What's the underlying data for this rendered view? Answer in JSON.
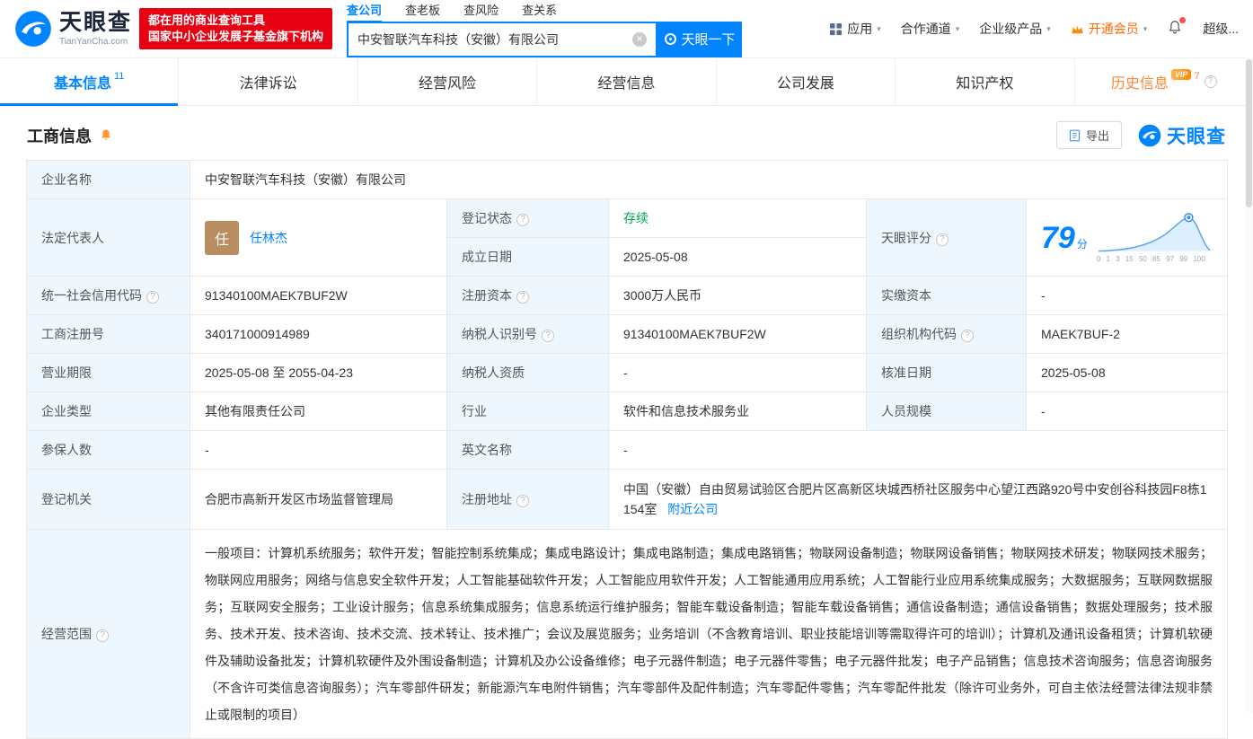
{
  "colors": {
    "brand_blue": "#0084ff",
    "promo_red": "#e60012",
    "status_green": "#00a854",
    "vip_orange": "#ff6a00",
    "history_orange": "#ff8534",
    "label_bg": "#eef7fe"
  },
  "header": {
    "brand": "天眼查",
    "brand_sub": "TianYanCha.com",
    "promo_line1": "都在用的商业查询工具",
    "promo_line2": "国家中小企业发展子基金旗下机构",
    "search_tabs": [
      {
        "label": "查公司"
      },
      {
        "label": "查老板"
      },
      {
        "label": "查风险"
      },
      {
        "label": "查关系"
      }
    ],
    "search_value": "中安智联汽车科技（安徽）有限公司",
    "search_button": "天眼一下",
    "nav": {
      "app": "应用",
      "cooperation": "合作通道",
      "enterprise": "企业级产品",
      "vip": "开通会员",
      "user": "超级..."
    }
  },
  "tabs": [
    {
      "label": "基本信息",
      "count": "11"
    },
    {
      "label": "法律诉讼"
    },
    {
      "label": "经营风险"
    },
    {
      "label": "经营信息"
    },
    {
      "label": "公司发展"
    },
    {
      "label": "知识产权"
    },
    {
      "label": "历史信息",
      "count": "7",
      "badge": "VIP"
    }
  ],
  "section": {
    "title": "工商信息",
    "export_label": "导出",
    "brand": "天眼查"
  },
  "score": {
    "value": "79",
    "unit": "分",
    "axis": "0 1 3 15 50 85 97 99 100"
  },
  "info": {
    "labels": {
      "company_name": "企业名称",
      "legal_rep": "法定代表人",
      "reg_status": "登记状态",
      "establish_date": "成立日期",
      "score": "天眼评分",
      "credit_code": "统一社会信用代码",
      "reg_capital": "注册资本",
      "paid_capital": "实缴资本",
      "reg_number": "工商注册号",
      "taxpayer_id": "纳税人识别号",
      "org_code": "组织机构代码",
      "business_term": "营业期限",
      "taxpayer_quality": "纳税人资质",
      "approval_date": "核准日期",
      "company_type": "企业类型",
      "industry": "行业",
      "staff_size": "人员规模",
      "insured_count": "参保人数",
      "english_name": "英文名称",
      "reg_authority": "登记机关",
      "reg_address": "注册地址",
      "business_scope": "经营范围"
    },
    "values": {
      "company_name": "中安智联汽车科技（安徽）有限公司",
      "legal_rep": "任林杰",
      "legal_rep_avatar": "任",
      "reg_status": "存续",
      "establish_date": "2025-05-08",
      "credit_code": "91340100MAEK7BUF2W",
      "reg_capital": "3000万人民币",
      "paid_capital": "-",
      "reg_number": "340171000914989",
      "taxpayer_id": "91340100MAEK7BUF2W",
      "org_code": "MAEK7BUF-2",
      "business_term": "2025-05-08 至 2055-04-23",
      "taxpayer_quality": "-",
      "approval_date": "2025-05-08",
      "company_type": "其他有限责任公司",
      "industry": "软件和信息技术服务业",
      "staff_size": "-",
      "insured_count": "-",
      "english_name": "-",
      "reg_authority": "合肥市高新开发区市场监督管理局",
      "reg_address": "中国（安徽）自由贸易试验区合肥片区高新区块城西桥社区服务中心望江西路920号中安创谷科技园F8栋1154室",
      "nearby_companies": "附近公司",
      "business_scope": "一般项目：计算机系统服务；软件开发；智能控制系统集成；集成电路设计；集成电路制造；集成电路销售；物联网设备制造；物联网设备销售；物联网技术研发；物联网技术服务；物联网应用服务；网络与信息安全软件开发；人工智能基础软件开发；人工智能应用软件开发；人工智能通用应用系统；人工智能行业应用系统集成服务；大数据服务；互联网数据服务；互联网安全服务；工业设计服务；信息系统集成服务；信息系统运行维护服务；智能车载设备制造；智能车载设备销售；通信设备制造；通信设备销售；数据处理服务；技术服务、技术开发、技术咨询、技术交流、技术转让、技术推广；会议及展览服务；业务培训（不含教育培训、职业技能培训等需取得许可的培训）；计算机及通讯设备租赁；计算机软硬件及辅助设备批发；计算机软硬件及外围设备制造；计算机及办公设备维修；电子元器件制造；电子元器件零售；电子元器件批发；电子产品销售；信息技术咨询服务；信息咨询服务（不含许可类信息咨询服务）；汽车零部件研发；新能源汽车电附件销售；汽车零部件及配件制造；汽车零配件零售；汽车零配件批发（除许可业务外，可自主依法经营法律法规非禁止或限制的项目）"
    }
  }
}
